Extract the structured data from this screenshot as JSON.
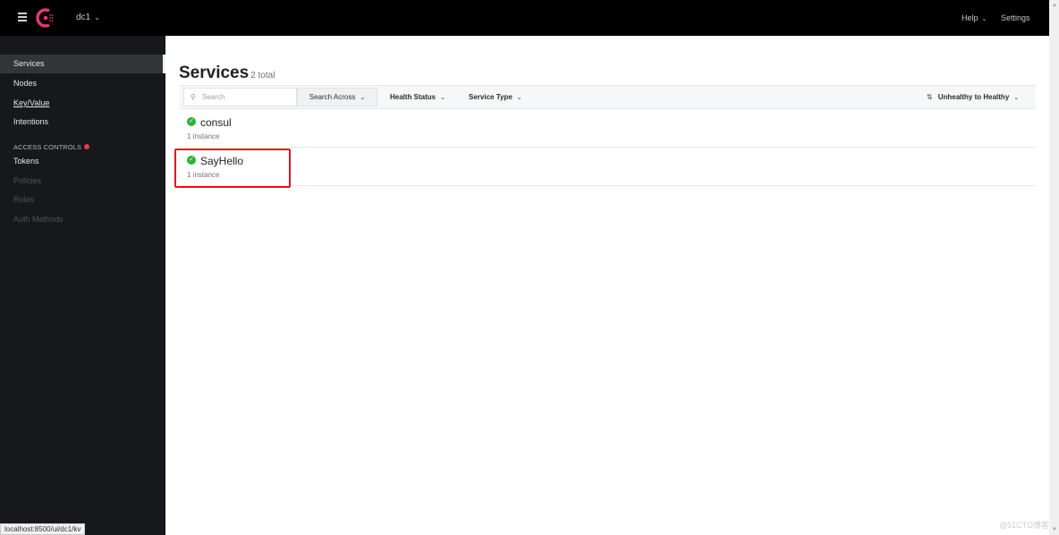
{
  "header": {
    "datacenter": "dc1",
    "help_label": "Help",
    "settings_label": "Settings",
    "brand_color": "#e03875"
  },
  "sidebar": {
    "items": [
      {
        "label": "Services",
        "active": true
      },
      {
        "label": "Nodes"
      },
      {
        "label": "Key/Value"
      },
      {
        "label": "Intentions"
      }
    ],
    "access_controls": {
      "label": "ACCESS CONTROLS",
      "items": [
        {
          "label": "Tokens",
          "enabled": true
        },
        {
          "label": "Policies",
          "enabled": false
        },
        {
          "label": "Roles",
          "enabled": false
        },
        {
          "label": "Auth Methods",
          "enabled": false
        }
      ]
    }
  },
  "main": {
    "title": "Services",
    "total": "2 total",
    "filters": {
      "search_placeholder": "Search",
      "search_across": "Search Across",
      "health_status": "Health Status",
      "service_type": "Service Type",
      "sort": "Unhealthy to Healthy"
    },
    "services": [
      {
        "name": "consul",
        "instances": "1 instance",
        "status": "passing"
      },
      {
        "name": "SayHello",
        "instances": "1 instance",
        "status": "passing",
        "highlighted": true
      }
    ]
  },
  "statusbar": {
    "url": "localhost:8500/ui/dc1/kv"
  },
  "watermark": "@51CTO博客"
}
